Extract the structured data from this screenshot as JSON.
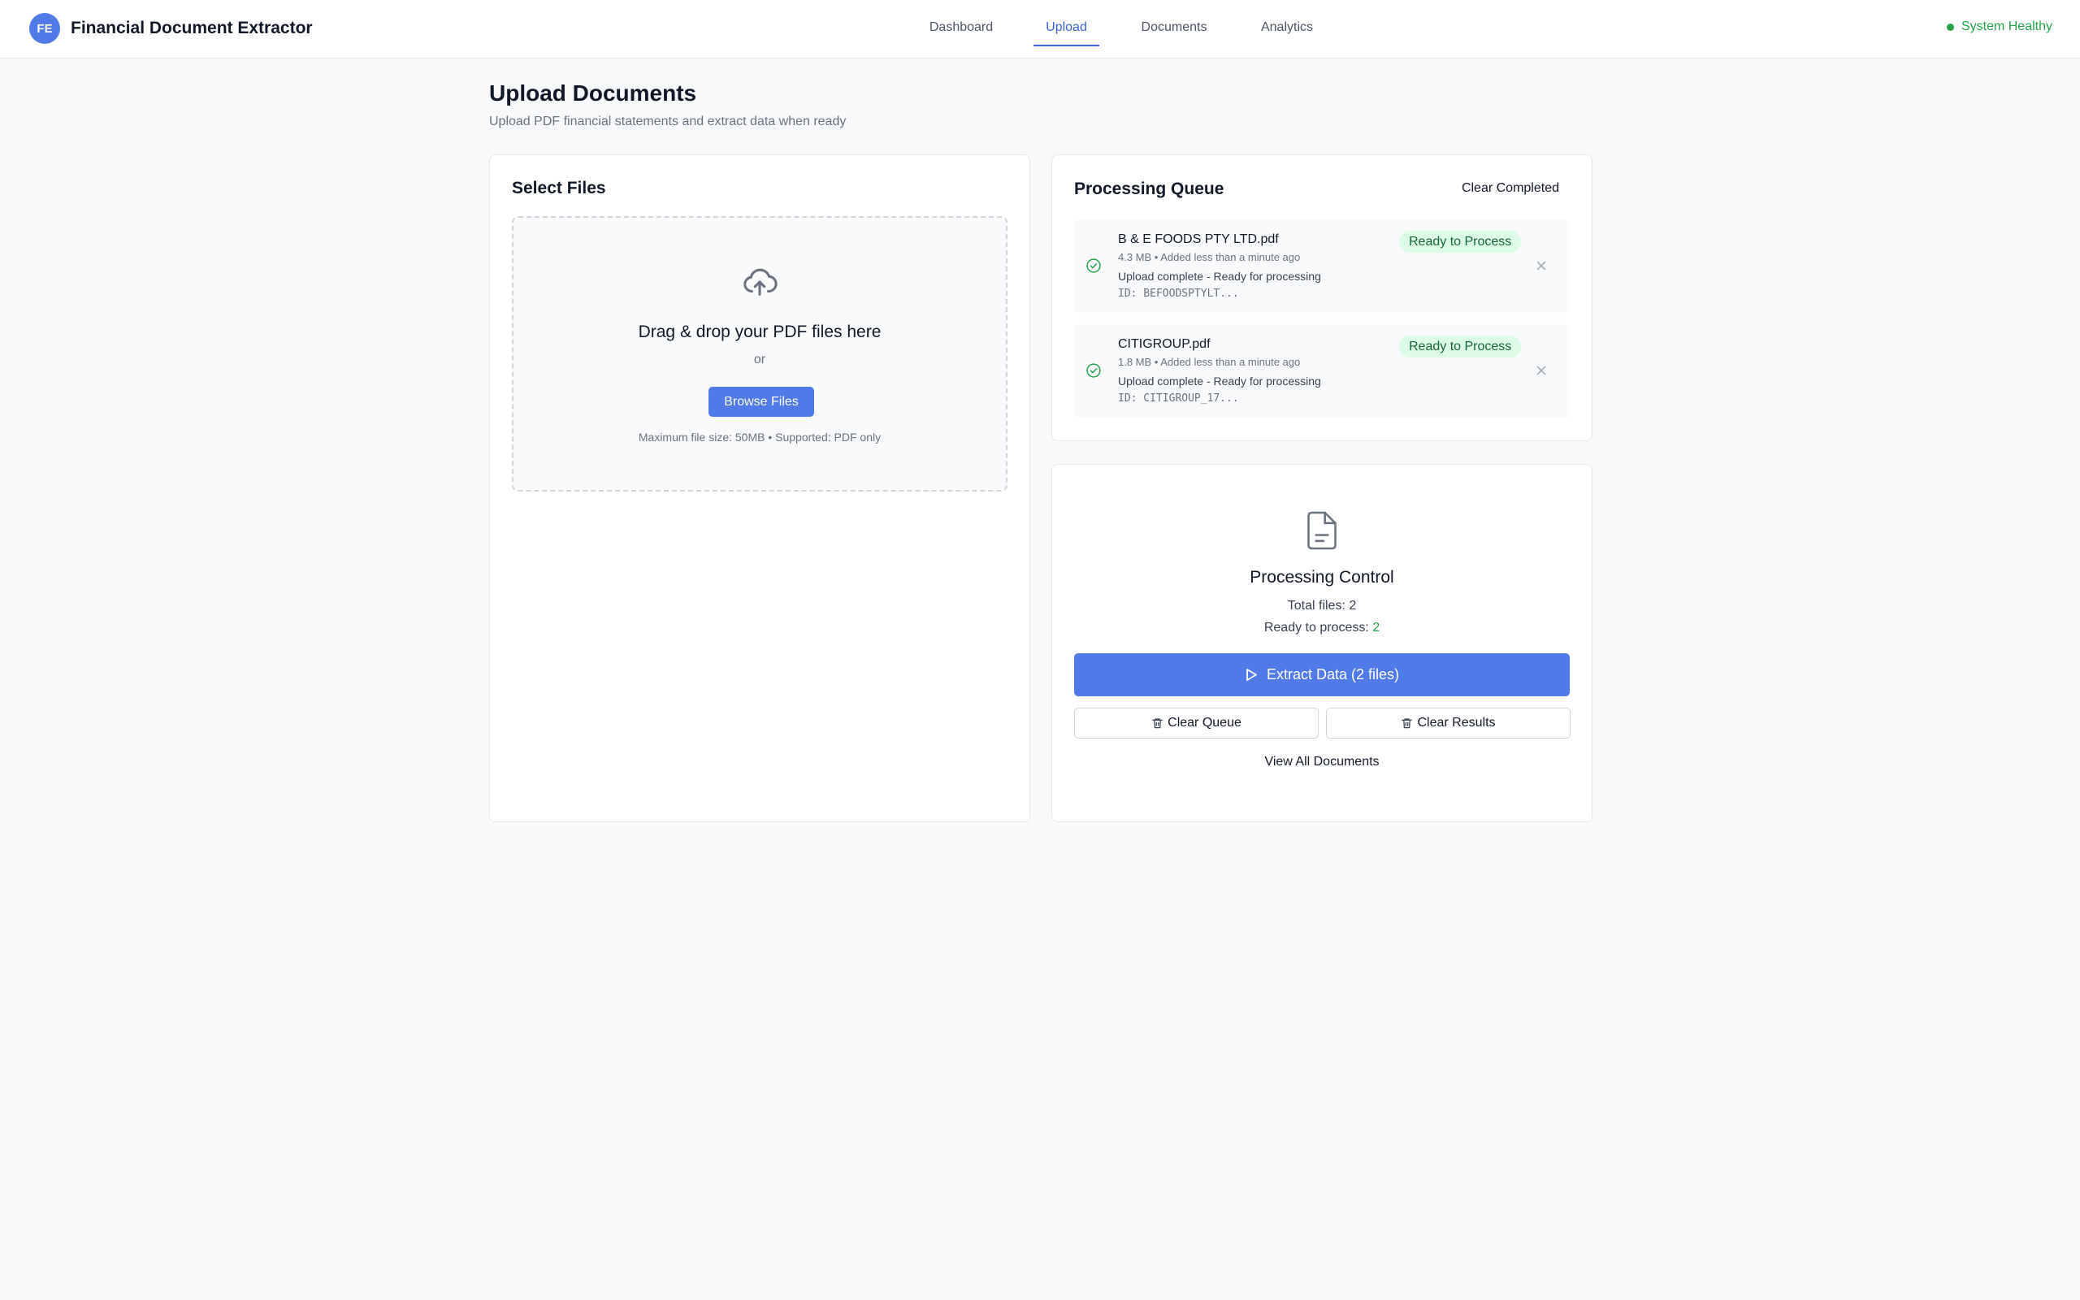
{
  "app": {
    "logo_initials": "FE",
    "title": "Financial Document Extractor",
    "brand_color": "#4f7ae8"
  },
  "nav": {
    "items": [
      {
        "label": "Dashboard",
        "active": false
      },
      {
        "label": "Upload",
        "active": true
      },
      {
        "label": "Documents",
        "active": false
      },
      {
        "label": "Analytics",
        "active": false
      }
    ]
  },
  "system_status": {
    "label": "System Healthy",
    "color": "#22a447",
    "icon": "status-dot"
  },
  "page": {
    "title": "Upload Documents",
    "subtitle": "Upload PDF financial statements and extract data when ready"
  },
  "select_files": {
    "title": "Select Files",
    "dropzone": {
      "icon": "cloud-upload-icon",
      "title": "Drag & drop your PDF files here",
      "or_text": "or",
      "browse_label": "Browse Files",
      "hint": "Maximum file size: 50MB • Supported: PDF only"
    }
  },
  "queue": {
    "title": "Processing Queue",
    "clear_completed_label": "Clear Completed",
    "items": [
      {
        "name": "B & E FOODS PTY LTD.pdf",
        "meta": "4.3 MB • Added less than a minute ago",
        "status": "Upload complete - Ready for processing",
        "id": "ID: BEFOODSPTYLT...",
        "badge": "Ready to Process",
        "icon": "check-circle-icon"
      },
      {
        "name": "CITIGROUP.pdf",
        "meta": "1.8 MB • Added less than a minute ago",
        "status": "Upload complete - Ready for processing",
        "id": "ID: CITIGROUP_17...",
        "badge": "Ready to Process",
        "icon": "check-circle-icon"
      }
    ]
  },
  "control": {
    "icon": "document-icon",
    "title": "Processing Control",
    "total_label": "Total files: ",
    "total_value": "2",
    "ready_label": "Ready to process: ",
    "ready_value": "2",
    "extract_label": "Extract Data (2 files)",
    "clear_queue_label": "Clear Queue",
    "clear_results_label": "Clear Results",
    "view_all_label": "View All Documents"
  }
}
